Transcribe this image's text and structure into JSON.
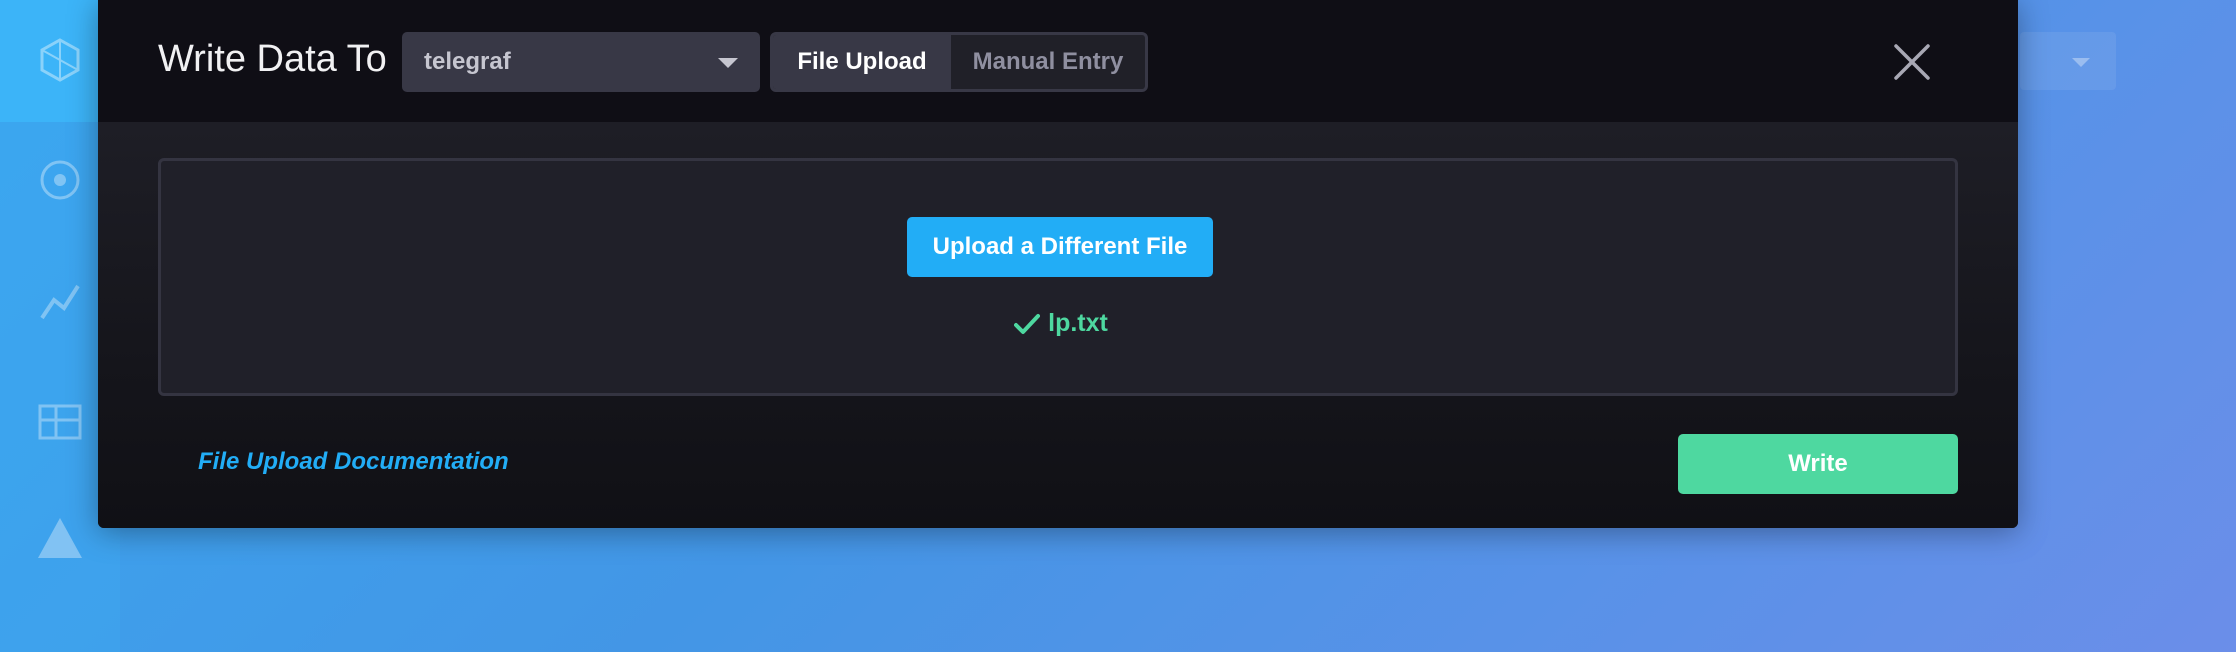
{
  "dialog": {
    "title": "Write Data To",
    "bucket_select": {
      "value": "telegraf",
      "icon": "caret-down-icon"
    },
    "mode_tabs": [
      {
        "label": "File Upload",
        "active": true
      },
      {
        "label": "Manual Entry",
        "active": false
      }
    ],
    "close_icon": "close-icon"
  },
  "dropzone": {
    "upload_button_label": "Upload a Different File",
    "file_name": "lp.txt",
    "file_status_icon": "checkmark-icon"
  },
  "footer": {
    "doc_link_label": "File Upload Documentation",
    "write_button_label": "Write"
  },
  "colors": {
    "primary": "#22adf6",
    "success": "#4ed8a0",
    "dialog_background": "#16161d",
    "header_background": "#0f0e15"
  },
  "background_nav": {
    "icons": [
      "logo-icon",
      "data-explorer-icon",
      "graph-icon",
      "dashboards-icon",
      "alert-icon"
    ]
  }
}
